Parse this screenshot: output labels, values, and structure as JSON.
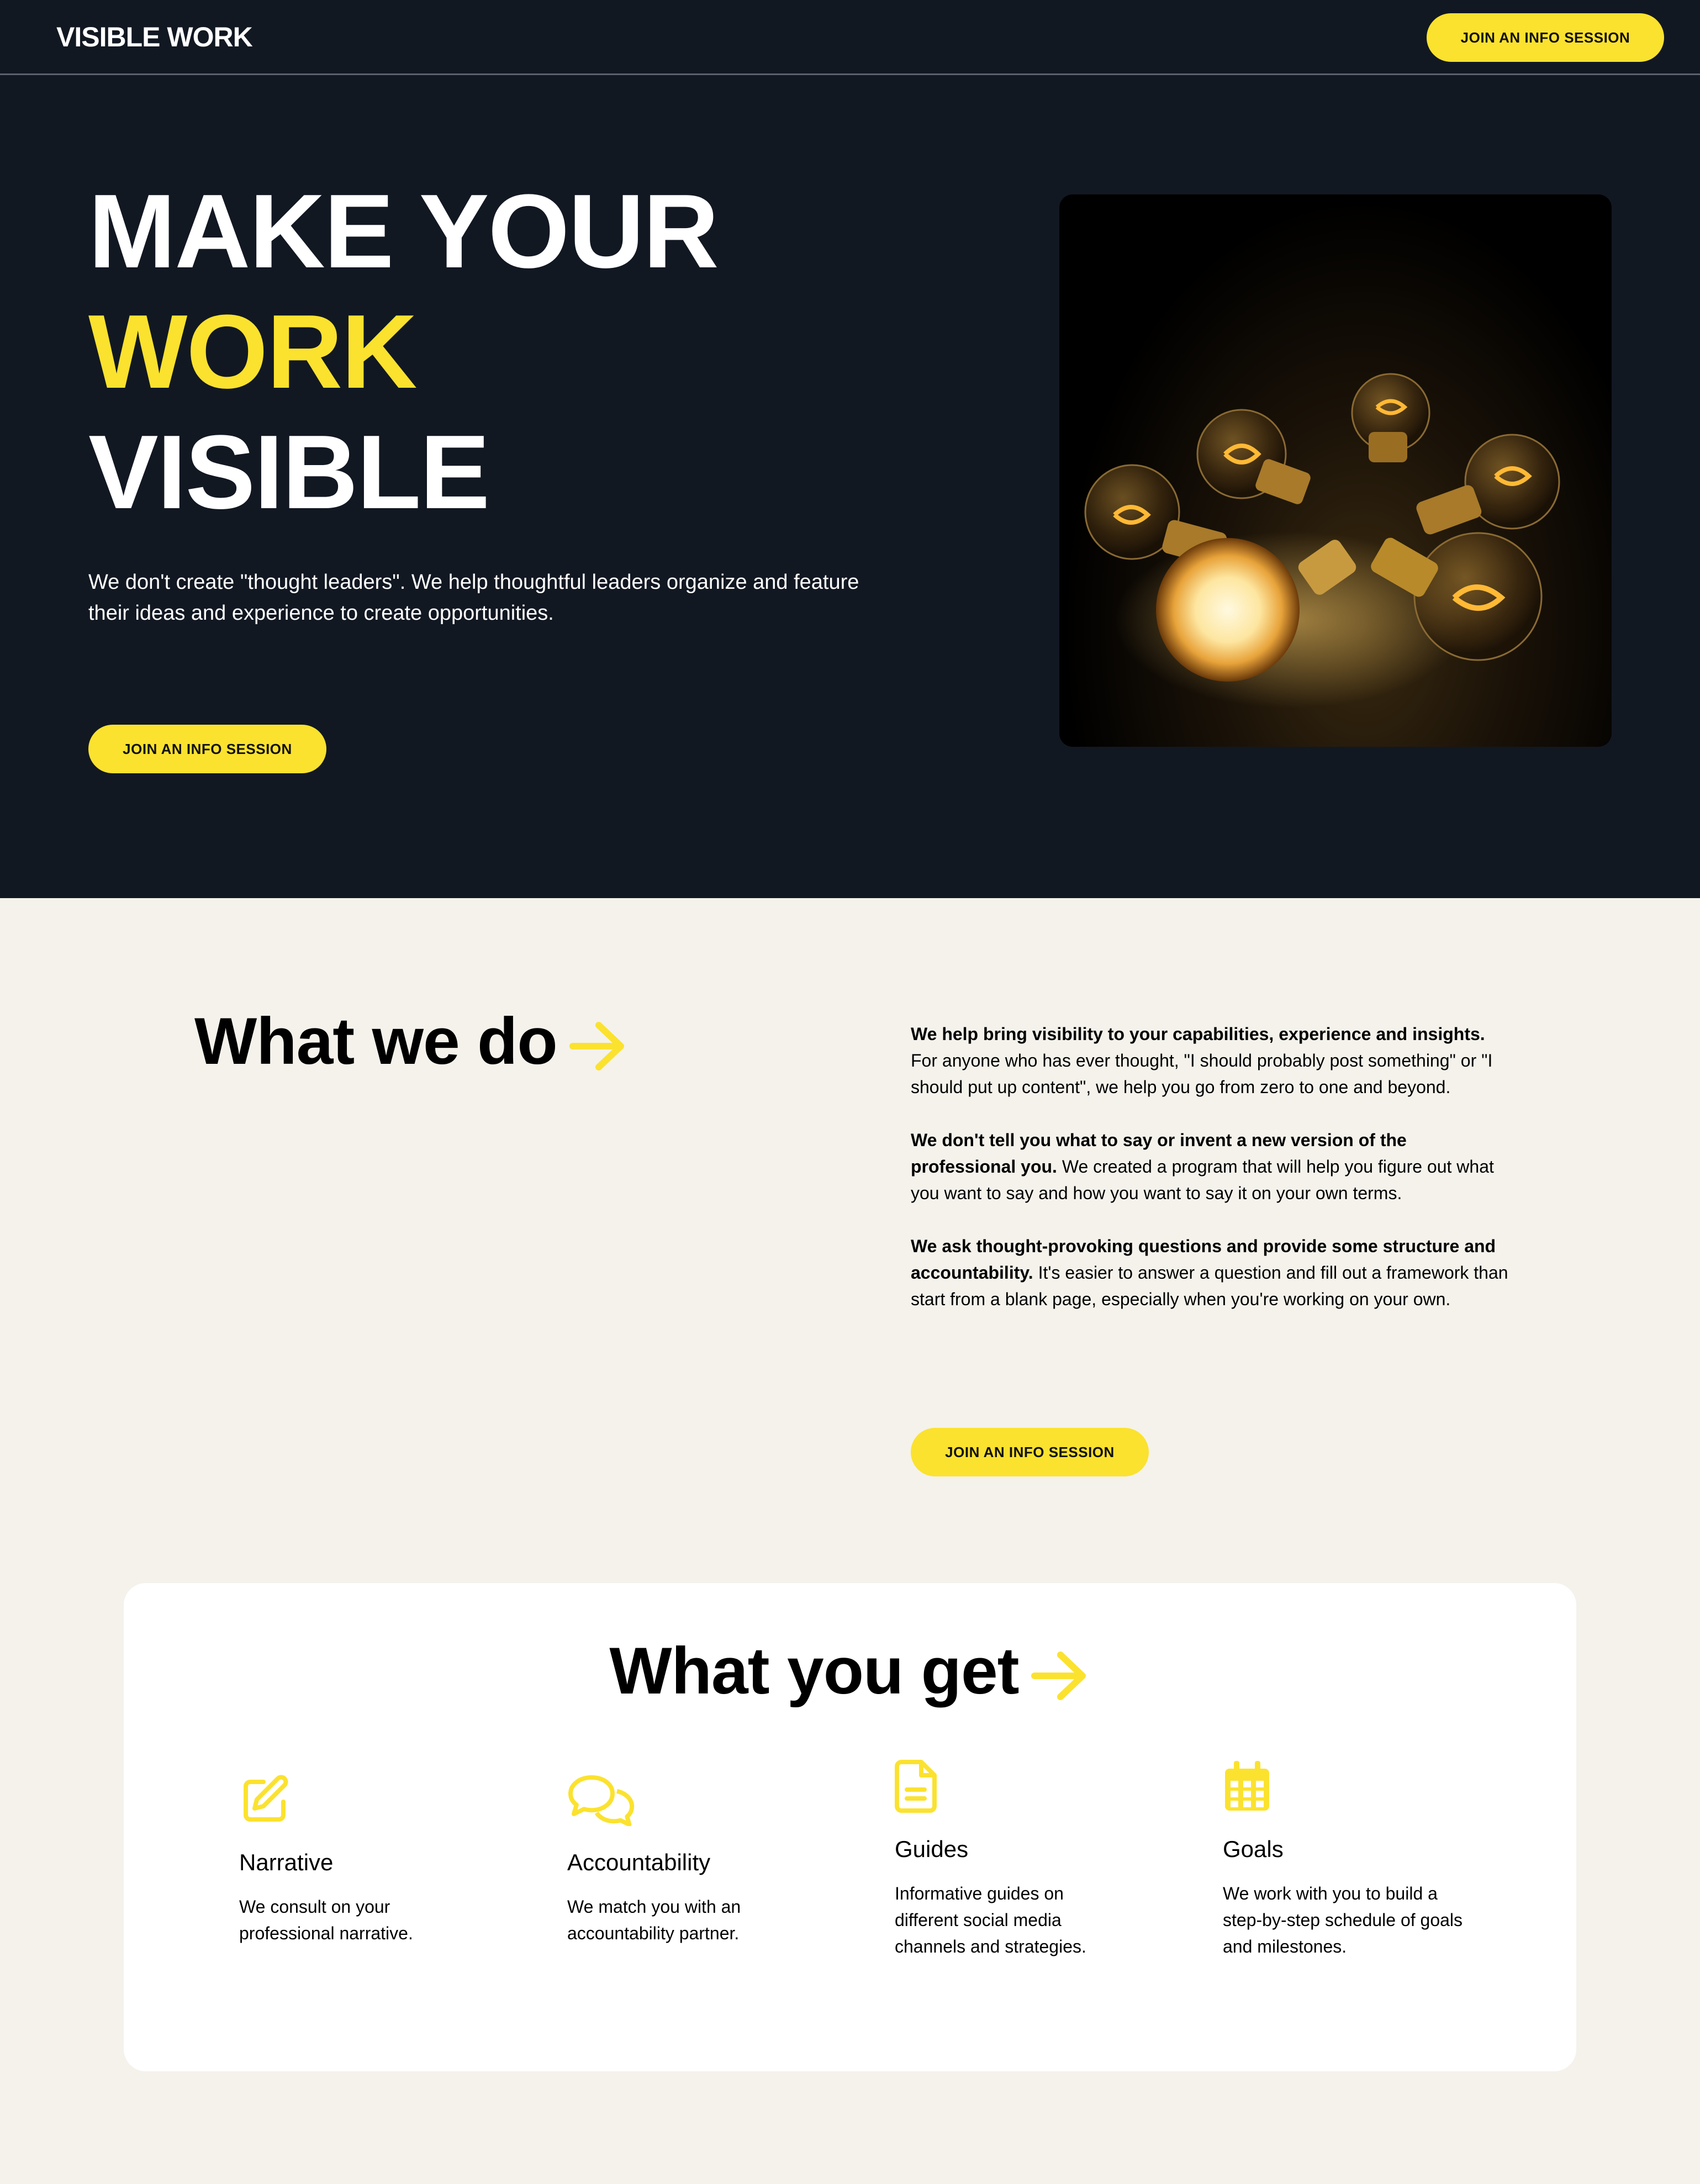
{
  "nav": {
    "logo": "VISIBLE WORK",
    "cta_label": "JOIN AN INFO SESSION"
  },
  "hero": {
    "headline_line1": "MAKE YOUR",
    "headline_line2": "WORK",
    "headline_line3": "VISIBLE",
    "subtitle": "We don't create \"thought leaders\". We help thoughtful leaders organize and feature their ideas and experience to create opportunities.",
    "cta_label": "JOIN AN INFO SESSION",
    "image_alt": "glowing-lightbulbs-photo"
  },
  "what_we_do": {
    "title": "What we do",
    "paragraphs": [
      {
        "bold": "We help bring visibility to your capabilities, experience and insights.",
        "text": " For anyone who has ever thought, \"I should probably post something\" or \"I should put up content\", we help you go from zero to one and beyond."
      },
      {
        "bold": "We don't tell you what to say or invent a new version of the professional you.",
        "text": " We created a program that will help you figure out what you want to say and how you want to say it on your own terms."
      },
      {
        "bold": "We ask thought-provoking questions and provide some structure and accountability.",
        "text": " It's easier to answer a question and fill out a framework than start from a blank page, especially when you're working on your own."
      }
    ],
    "cta_label": "JOIN AN INFO SESSION"
  },
  "what_you_get": {
    "title": "What you get",
    "features": [
      {
        "icon": "edit-icon",
        "title": "Narrative",
        "desc": "We consult on your professional narrative."
      },
      {
        "icon": "chat-icon",
        "title": "Accountability",
        "desc": "We match you with an accountability partner."
      },
      {
        "icon": "document-icon",
        "title": "Guides",
        "desc": "Informative guides on different social media channels and strategies."
      },
      {
        "icon": "calendar-icon",
        "title": "Goals",
        "desc": "We work with you to build a step-by-step schedule of goals and milestones."
      }
    ]
  },
  "colors": {
    "accent": "#fbe22f",
    "dark_bg": "#121822",
    "cream_bg": "#f4f2eb"
  }
}
